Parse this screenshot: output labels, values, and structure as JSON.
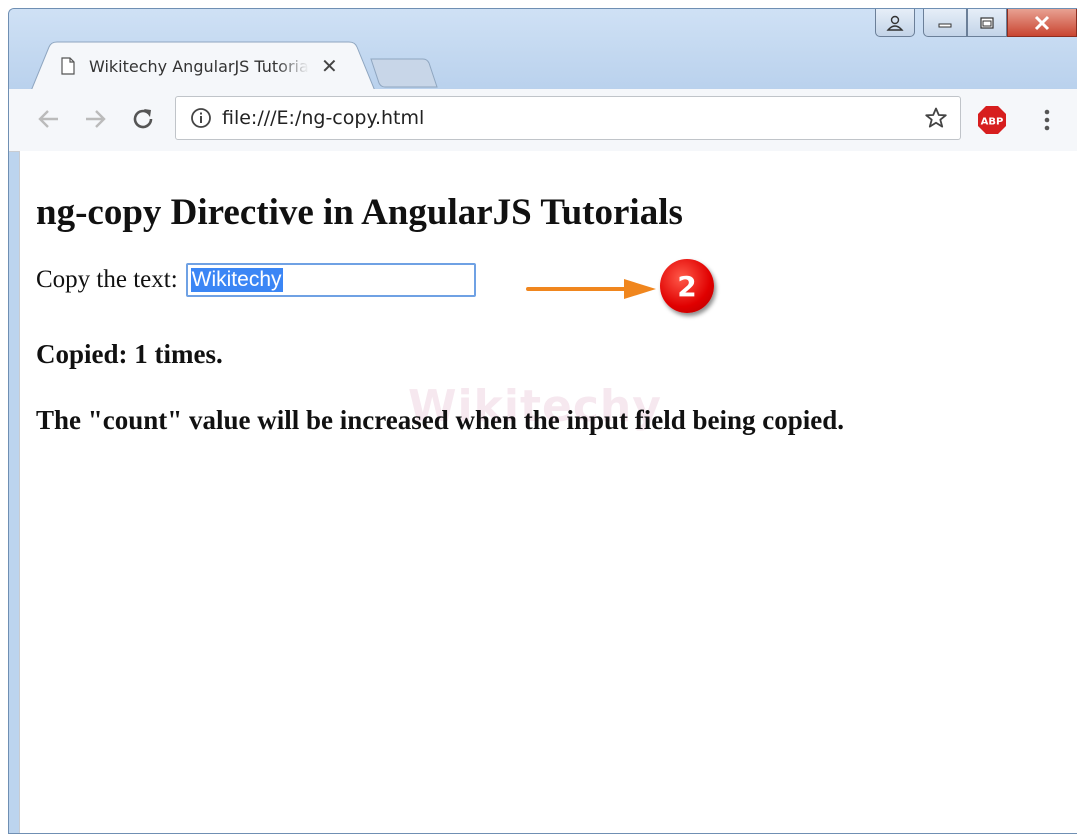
{
  "browser": {
    "tab_title": "Wikitechy AngularJS Tutorials",
    "url": "file:///E:/ng-copy.html",
    "abp_label": "ABP",
    "icons": {
      "tab": "document-icon",
      "close": "close-icon",
      "back": "back-arrow-icon",
      "forward": "forward-arrow-icon",
      "reload": "reload-icon",
      "info": "info-icon",
      "star": "star-icon",
      "adblock": "adblock-icon",
      "menu": "vertical-dots-icon"
    }
  },
  "page": {
    "heading": "ng-copy Directive in AngularJS Tutorials",
    "copy_label": "Copy the text:",
    "input_value": "Wikitechy",
    "copied_text": "Copied: 1 times.",
    "note": "The \"count\" value will be increased when the input field being copied.",
    "watermark": "Wikitechy"
  },
  "annotation": {
    "step_number": "2",
    "arrow_color": "#f0861e",
    "badge_color": "#e00000"
  }
}
